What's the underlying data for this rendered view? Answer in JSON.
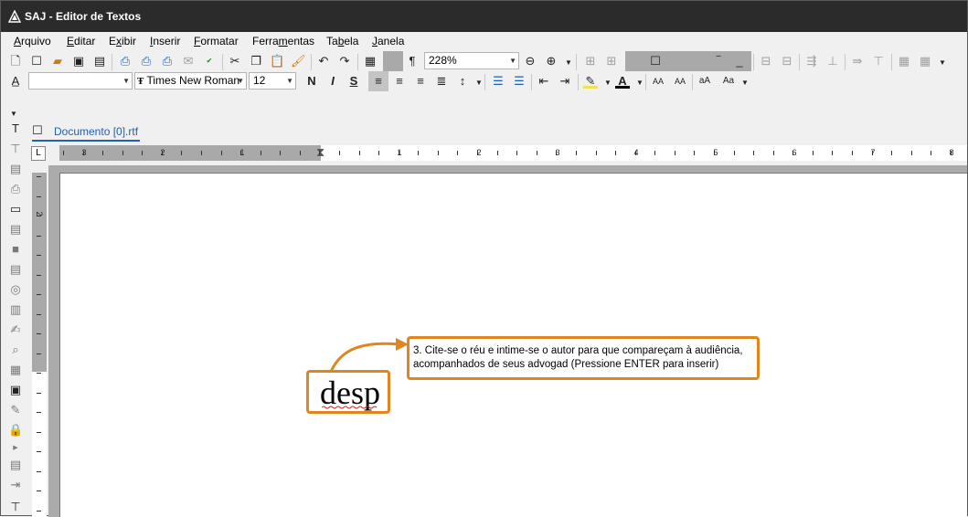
{
  "window": {
    "title": "SAJ - Editor de Textos"
  },
  "menu": [
    {
      "label": "Arquivo",
      "key": "A"
    },
    {
      "label": "Editar",
      "key": "E"
    },
    {
      "label": "Exibir",
      "key": "x"
    },
    {
      "label": "Inserir",
      "key": "I"
    },
    {
      "label": "Formatar",
      "key": "F"
    },
    {
      "label": "Ferramentas",
      "key": "m"
    },
    {
      "label": "Tabela",
      "key": "b"
    },
    {
      "label": "Janela",
      "key": "J"
    }
  ],
  "toolbar": {
    "zoom": "228%",
    "font_name": "Times New Roman",
    "font_size": "12",
    "style_value": "",
    "bold": "N",
    "italic": "I",
    "underline": "S",
    "font_color_letter": "A",
    "size_up": "AA",
    "size_down": "AA"
  },
  "document": {
    "tab_label": "Documento [0].rtf",
    "typed_text": "desp",
    "suggestion": "3. Cite-se o réu e intime-se o autor para que compareçam à audiência, acompanhados de seus advogad (Pressione ENTER para inserir)"
  },
  "ruler": {
    "left_numbers": [
      "3",
      "2",
      "1"
    ],
    "right_numbers": [
      "1",
      "2",
      "3",
      "4",
      "5",
      "6",
      "7",
      "8"
    ],
    "vertical_numbers": [
      "2"
    ]
  },
  "colors": {
    "highlight": "#e0861e",
    "accent": "#1f5fb4",
    "titlebar": "#2b2b2b"
  }
}
